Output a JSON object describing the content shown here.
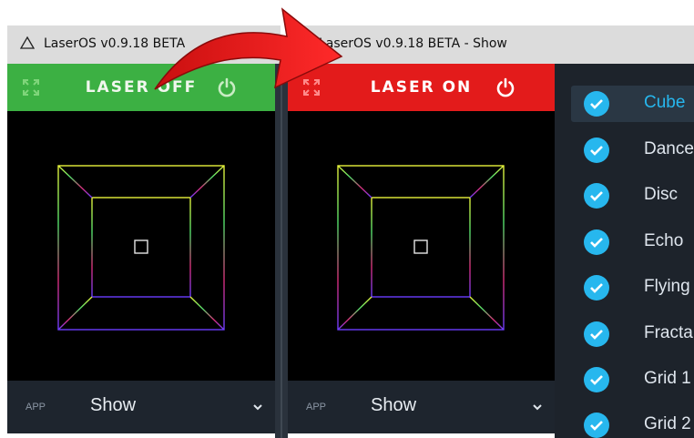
{
  "window_left": {
    "title": "LaserOS v0.9.18 BETA",
    "laser_label": "LASER OFF",
    "laser_state": "off",
    "bar_color": "#3cb043",
    "app_tag": "APP",
    "app_value": "Show"
  },
  "window_right": {
    "title": "LaserOS v0.9.18 BETA - Show",
    "laser_label": "LASER ON",
    "laser_state": "on",
    "bar_color": "#e31b1b",
    "app_tag": "APP",
    "app_value": "Show"
  },
  "show_list": [
    {
      "label": "Cube",
      "checked": true,
      "selected": true
    },
    {
      "label": "Dance",
      "checked": true,
      "selected": false
    },
    {
      "label": "Disc",
      "checked": true,
      "selected": false
    },
    {
      "label": "Echo",
      "checked": true,
      "selected": false
    },
    {
      "label": "Flying",
      "checked": true,
      "selected": false
    },
    {
      "label": "Fracta",
      "checked": true,
      "selected": false
    },
    {
      "label": "Grid 1",
      "checked": true,
      "selected": false
    },
    {
      "label": "Grid 2",
      "checked": true,
      "selected": false
    }
  ],
  "icons": {
    "title": "warning-triangle-icon",
    "expand": "expand-icon",
    "power": "power-icon",
    "chevron": "chevron-down-icon",
    "check": "check-circle-icon",
    "arrow": "red-curved-arrow"
  },
  "colors": {
    "accent": "#27b7ee",
    "annotation_arrow": "#e31b1b"
  }
}
